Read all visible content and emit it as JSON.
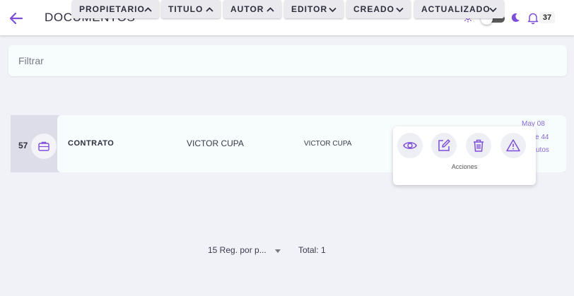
{
  "header": {
    "title": "DOCUMENTOS",
    "notification_count": "37"
  },
  "filter": {
    "placeholder": "Filtrar",
    "value": ""
  },
  "sort_columns": [
    {
      "label": "PROPIETARIO",
      "direction": "up"
    },
    {
      "label": "TITULO",
      "direction": "up"
    },
    {
      "label": "AUTOR",
      "direction": "up"
    },
    {
      "label": "EDITOR",
      "direction": "down"
    },
    {
      "label": "CREADO",
      "direction": "down"
    },
    {
      "label": "ACTUALIZADO",
      "direction": "down"
    }
  ],
  "rows": [
    {
      "number": "57",
      "title": "CONTRATO",
      "owner": "VICTOR CUPA",
      "author": "VICTOR CUPA",
      "date_fragments": [
        "May 08",
        "e 44",
        "utos"
      ]
    }
  ],
  "actions_menu": {
    "label": "Acciones",
    "buttons": [
      "view",
      "edit",
      "delete",
      "report"
    ]
  },
  "pagination": {
    "per_page_label": "15 Reg. por p...",
    "total_label": "Total: 1"
  },
  "colors": {
    "accent": "#7d4fd8",
    "background": "#f1f2f8",
    "card": "#f7fcfd"
  }
}
